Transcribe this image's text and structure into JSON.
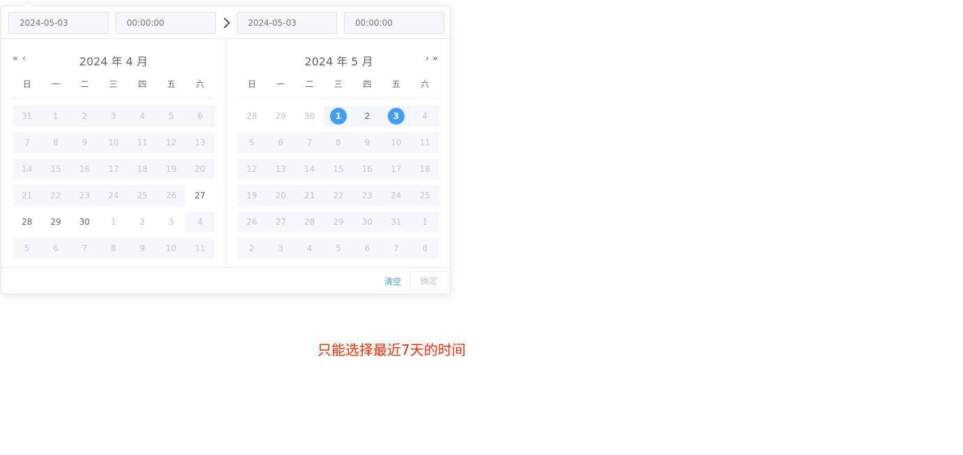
{
  "header": {
    "start_date": "2024-05-03",
    "start_time": "00:00:00",
    "end_date": "2024-05-03",
    "end_time": "00:00:00"
  },
  "left": {
    "title": "2024 年 4 月",
    "nav_prev_year": "«",
    "nav_prev_month": "‹"
  },
  "right": {
    "title": "2024 年 5 月",
    "nav_next_month": "›",
    "nav_next_year": "»"
  },
  "weekdays": [
    "日",
    "一",
    "二",
    "三",
    "四",
    "五",
    "六"
  ],
  "left_days": [
    [
      "31",
      "d"
    ],
    [
      "1",
      "d"
    ],
    [
      "2",
      "d"
    ],
    [
      "3",
      "d"
    ],
    [
      "4",
      "d"
    ],
    [
      "5",
      "d"
    ],
    [
      "6",
      "d"
    ],
    [
      "7",
      "d"
    ],
    [
      "8",
      "d"
    ],
    [
      "9",
      "d"
    ],
    [
      "10",
      "d"
    ],
    [
      "11",
      "d"
    ],
    [
      "12",
      "d"
    ],
    [
      "13",
      "d"
    ],
    [
      "14",
      "d"
    ],
    [
      "15",
      "d"
    ],
    [
      "16",
      "d"
    ],
    [
      "17",
      "d"
    ],
    [
      "18",
      "d"
    ],
    [
      "19",
      "d"
    ],
    [
      "20",
      "d"
    ],
    [
      "21",
      "d"
    ],
    [
      "22",
      "d"
    ],
    [
      "23",
      "d"
    ],
    [
      "24",
      "d"
    ],
    [
      "25",
      "d"
    ],
    [
      "26",
      "d"
    ],
    [
      "27",
      "e"
    ],
    [
      "28",
      "e"
    ],
    [
      "29",
      "e"
    ],
    [
      "30",
      "e"
    ],
    [
      "1",
      "n"
    ],
    [
      "2",
      "n"
    ],
    [
      "3",
      "n"
    ],
    [
      "4",
      "d"
    ],
    [
      "5",
      "d"
    ],
    [
      "6",
      "d"
    ],
    [
      "7",
      "d"
    ],
    [
      "8",
      "d"
    ],
    [
      "9",
      "d"
    ],
    [
      "10",
      "d"
    ],
    [
      "11",
      "d"
    ]
  ],
  "right_days": [
    [
      "28",
      "n"
    ],
    [
      "29",
      "n"
    ],
    [
      "30",
      "n"
    ],
    [
      "1",
      "s"
    ],
    [
      "2",
      "r"
    ],
    [
      "3",
      "s"
    ],
    [
      "4",
      "d"
    ],
    [
      "5",
      "d"
    ],
    [
      "6",
      "d"
    ],
    [
      "7",
      "d"
    ],
    [
      "8",
      "d"
    ],
    [
      "9",
      "d"
    ],
    [
      "10",
      "d"
    ],
    [
      "11",
      "d"
    ],
    [
      "12",
      "d"
    ],
    [
      "13",
      "d"
    ],
    [
      "14",
      "d"
    ],
    [
      "15",
      "d"
    ],
    [
      "16",
      "d"
    ],
    [
      "17",
      "d"
    ],
    [
      "18",
      "d"
    ],
    [
      "19",
      "d"
    ],
    [
      "20",
      "d"
    ],
    [
      "21",
      "d"
    ],
    [
      "22",
      "d"
    ],
    [
      "23",
      "d"
    ],
    [
      "24",
      "d"
    ],
    [
      "25",
      "d"
    ],
    [
      "26",
      "d"
    ],
    [
      "27",
      "d"
    ],
    [
      "28",
      "d"
    ],
    [
      "29",
      "d"
    ],
    [
      "30",
      "d"
    ],
    [
      "31",
      "d"
    ],
    [
      "1",
      "d"
    ],
    [
      "2",
      "d"
    ],
    [
      "3",
      "d"
    ],
    [
      "4",
      "d"
    ],
    [
      "5",
      "d"
    ],
    [
      "6",
      "d"
    ],
    [
      "7",
      "d"
    ],
    [
      "8",
      "d"
    ]
  ],
  "footer": {
    "clear_label": "清空",
    "confirm_label": "确定"
  },
  "note": "只能选择最近7天的时间",
  "colors": {
    "accent": "#409eff",
    "disabled_bg": "#f5f7fa",
    "range_bg": "#f2f6fc",
    "note": "#ff2a00"
  }
}
